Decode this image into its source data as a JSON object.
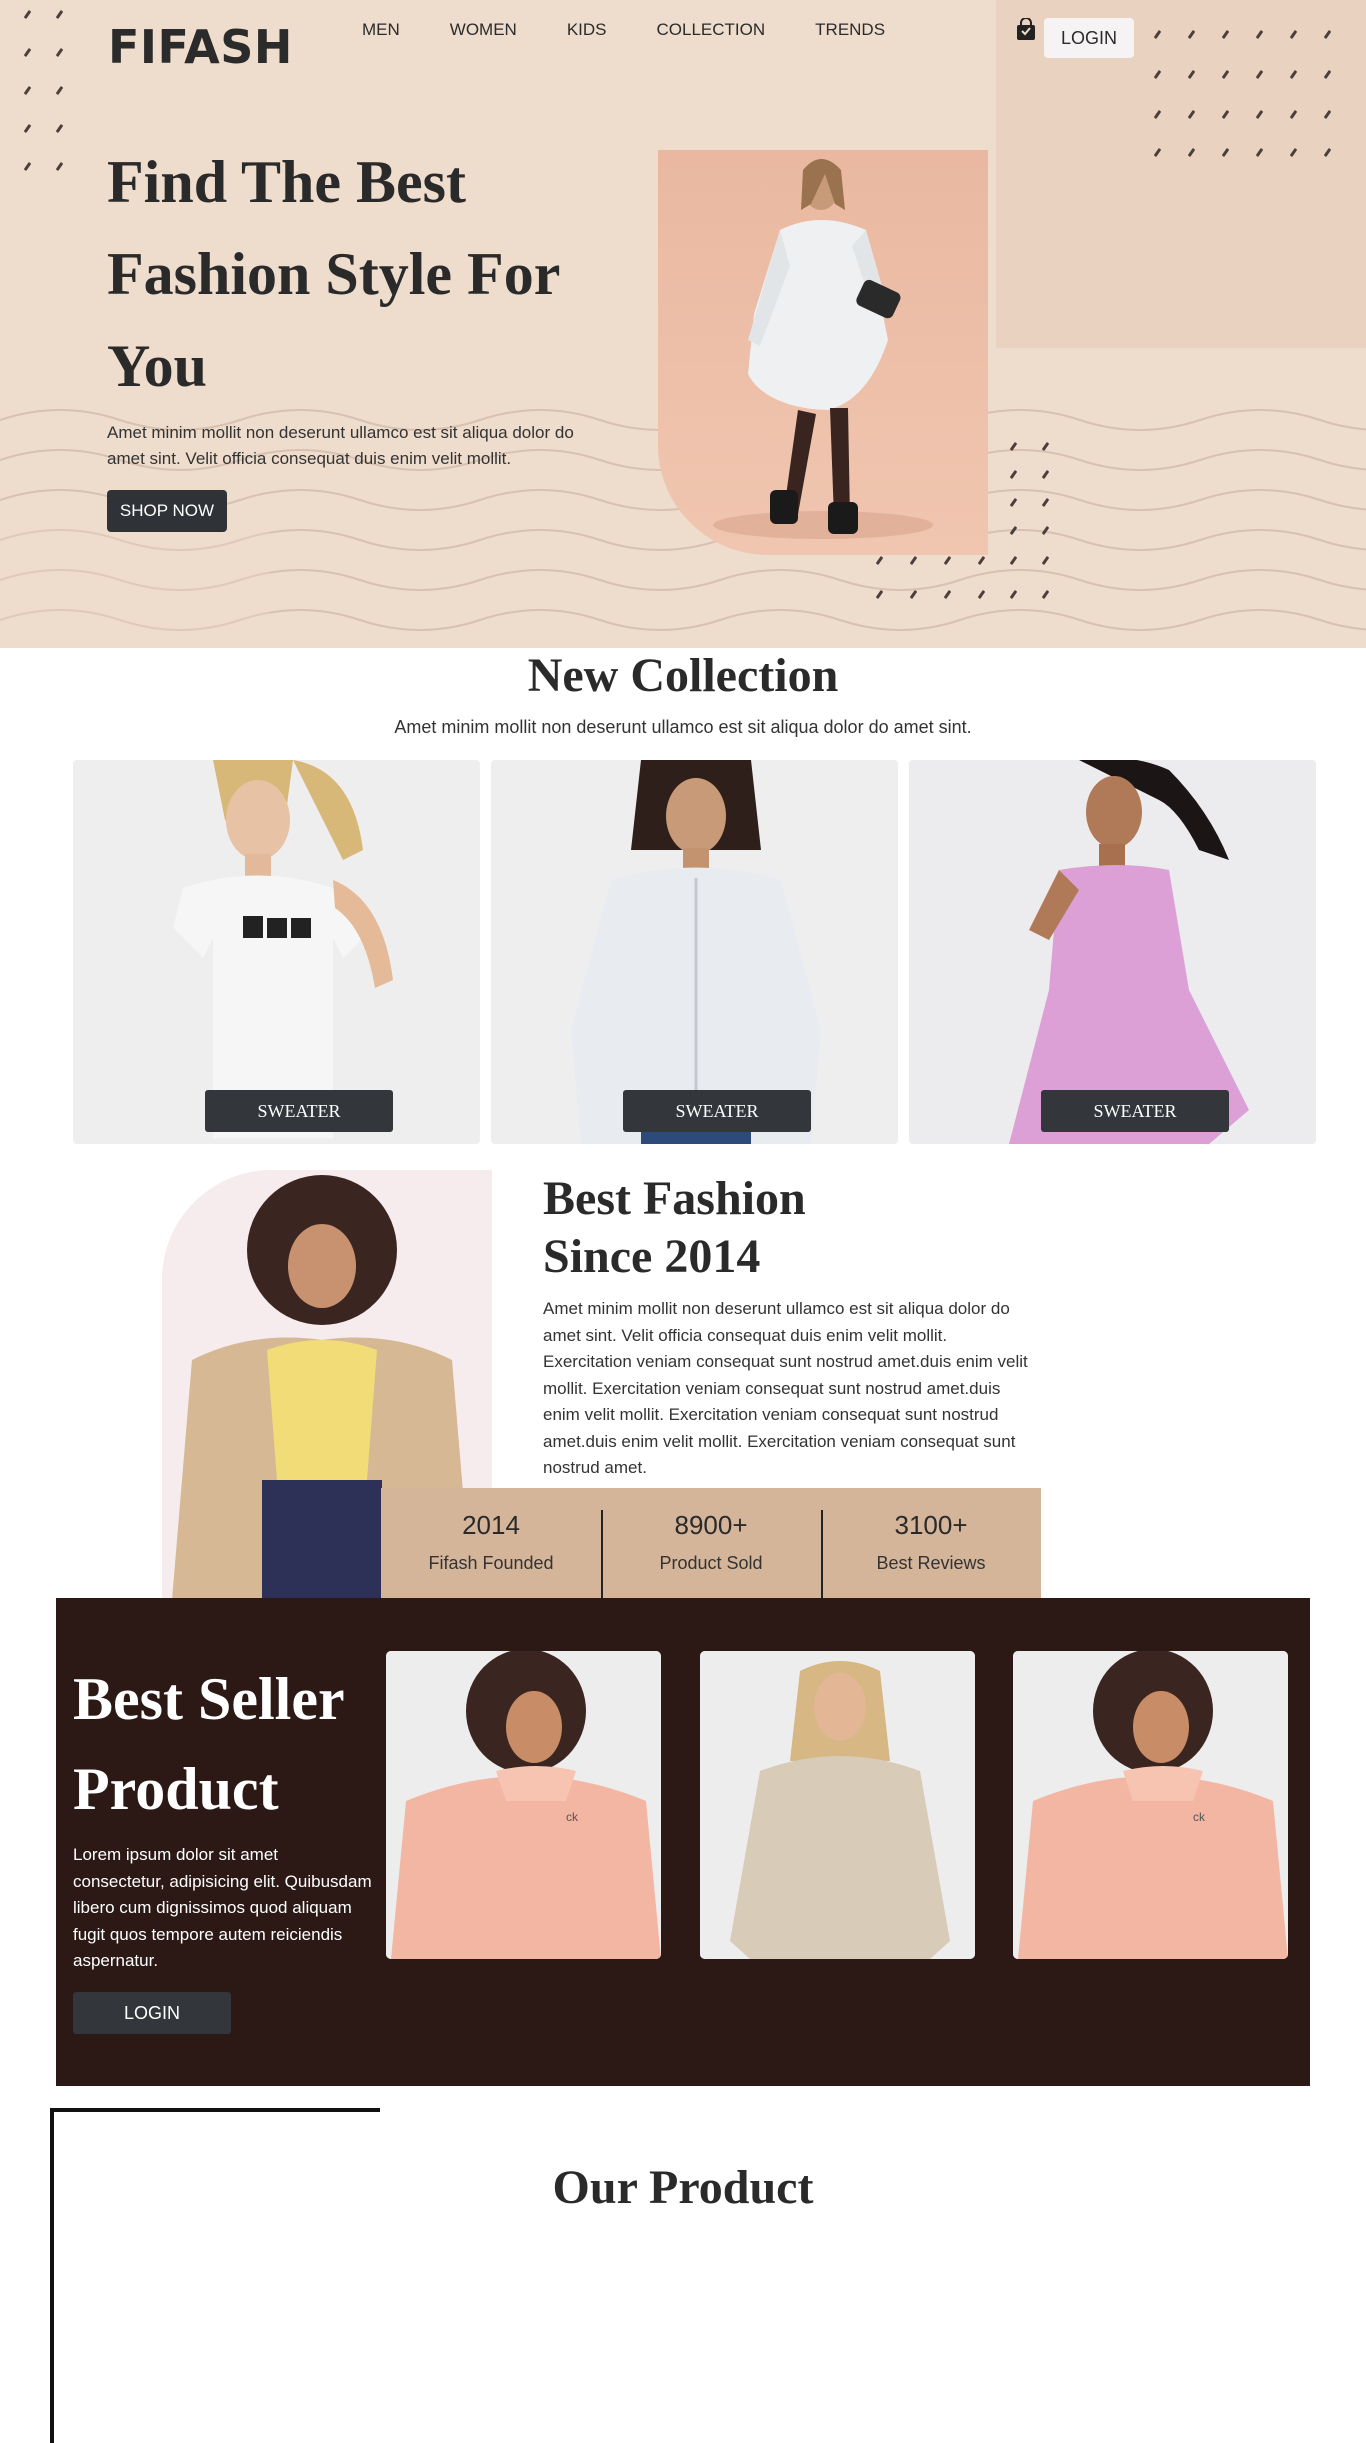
{
  "header": {
    "logo": "FIFASH",
    "nav": [
      "MEN",
      "WOMEN",
      "KIDS",
      "COLLECTION",
      "TRENDS"
    ],
    "bag_icon": "shopping-bag-icon",
    "login_label": "LOGIN"
  },
  "hero": {
    "title": "Find The Best Fashion Style For You",
    "text": "Amet minim mollit non deserunt ullamco est sit aliqua dolor do amet sint. Velit officia consequat duis enim velit mollit.",
    "button_label": "SHOP NOW",
    "colors": {
      "background": "#eedccc",
      "accent_block": "#ead2c0",
      "photo_bg": "#eab8a0"
    }
  },
  "new_collection": {
    "title": "New Collection",
    "subtitle": "Amet minim mollit non deserunt ullamco est sit aliqua dolor do amet sint.",
    "cards": [
      {
        "button_label": "SWEATER"
      },
      {
        "button_label": "SWEATER"
      },
      {
        "button_label": "SWEATER"
      }
    ]
  },
  "best_fashion": {
    "title_line1": "Best Fashion",
    "title_line2": "Since 2014",
    "text": "Amet minim mollit non deserunt ullamco est sit aliqua dolor do amet sint. Velit officia consequat duis enim velit mollit. Exercitation veniam consequat sunt nostrud amet.duis enim velit mollit. Exercitation veniam consequat sunt nostrud amet.duis enim velit mollit. Exercitation veniam consequat sunt nostrud amet.duis enim velit mollit. Exercitation veniam consequat sunt nostrud amet.",
    "stats": [
      {
        "value": "2014",
        "label": "Fifash Founded"
      },
      {
        "value": "8900+",
        "label": "Product Sold"
      },
      {
        "value": "3100+",
        "label": "Best Reviews"
      }
    ],
    "colors": {
      "stats_bg": "#d4b59a"
    }
  },
  "best_seller": {
    "title": "Best Seller Product",
    "text": "Lorem ipsum dolor sit amet consectetur, adipisicing elit. Quibusdam libero cum dignissimos quod aliquam fugit quos tempore autem reiciendis aspernatur.",
    "button_label": "LOGIN",
    "colors": {
      "background": "#2c1916"
    }
  },
  "our_product": {
    "title": "Our Product"
  }
}
